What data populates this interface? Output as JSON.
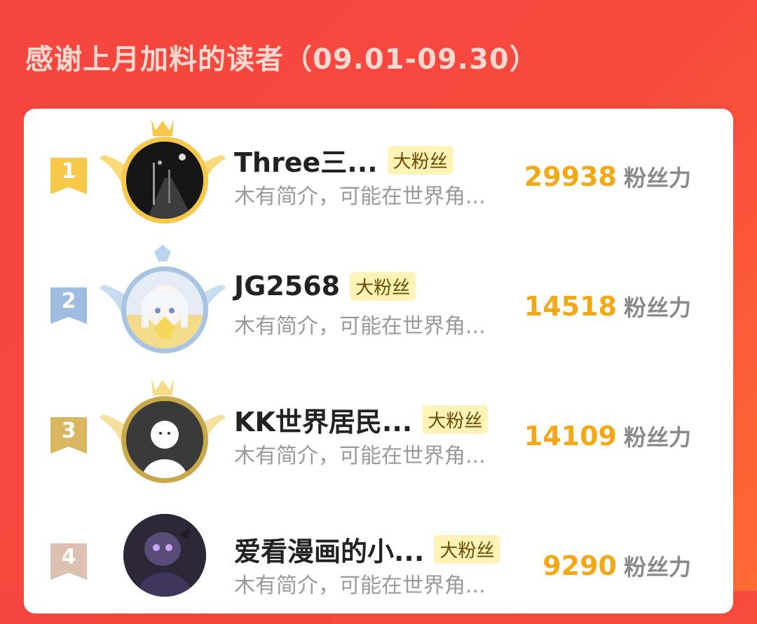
{
  "title": "感谢上月加料的读者（09.01-09.30）",
  "readers": [
    {
      "rank": "1",
      "name": "Three三...",
      "badge": "大粉丝",
      "bio": "木有简介，可能在世界角...",
      "score": "29938",
      "unit": "粉丝力",
      "rank_color": "#f5c542",
      "avatar_icon": "street-photo-avatar"
    },
    {
      "rank": "2",
      "name": "JG2568",
      "badge": "大粉丝",
      "bio": "木有简介，可能在世界角...",
      "score": "14518",
      "unit": "粉丝力",
      "rank_color": "#8fb2d8",
      "avatar_icon": "anime-girl-avatar"
    },
    {
      "rank": "3",
      "name": "KK世界居民...",
      "badge": "大粉丝",
      "bio": "木有简介，可能在世界角...",
      "score": "14109",
      "unit": "粉丝力",
      "rank_color": "#d6b45a",
      "avatar_icon": "ghost-avatar"
    },
    {
      "rank": "4",
      "name": "爱看漫画的小...",
      "badge": "大粉丝",
      "bio": "木有简介，可能在世界角...",
      "score": "9290",
      "unit": "粉丝力",
      "rank_color": "#d8b8a8",
      "avatar_icon": "dark-character-avatar"
    }
  ]
}
